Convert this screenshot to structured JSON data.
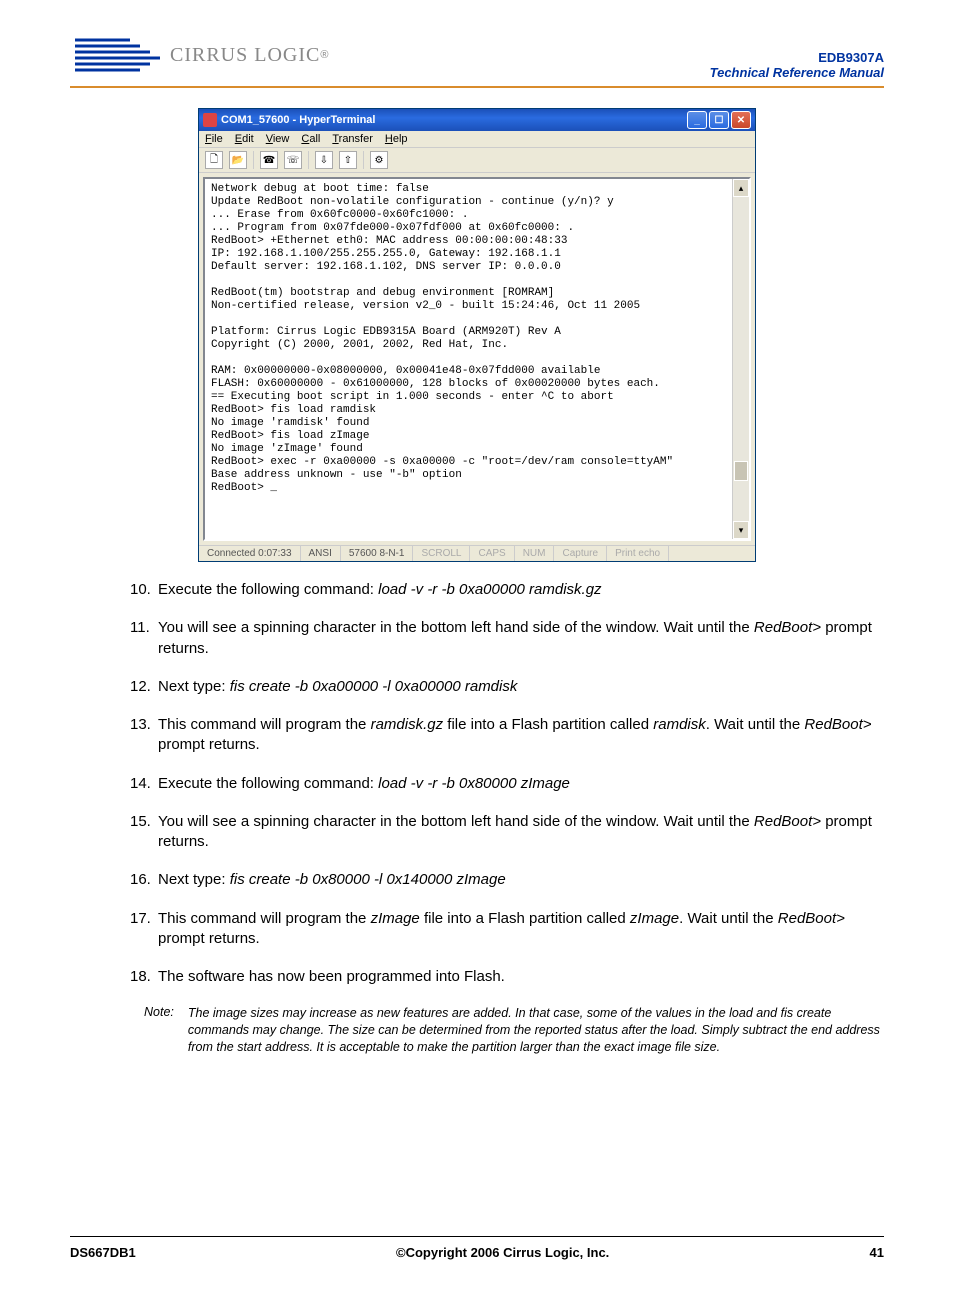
{
  "header": {
    "brand": "CIRRUS LOGIC",
    "product_code": "EDB9307A",
    "subtitle": "Technical Reference Manual"
  },
  "window": {
    "title": "COM1_57600 - HyperTerminal",
    "menu": {
      "file": "File",
      "edit": "Edit",
      "view": "View",
      "call": "Call",
      "transfer": "Transfer",
      "help": "Help"
    },
    "terminal_text": "Network debug at boot time: false\nUpdate RedBoot non-volatile configuration - continue (y/n)? y\n... Erase from 0x60fc0000-0x60fc1000: .\n... Program from 0x07fde000-0x07fdf000 at 0x60fc0000: .\nRedBoot> +Ethernet eth0: MAC address 00:00:00:00:48:33\nIP: 192.168.1.100/255.255.255.0, Gateway: 192.168.1.1\nDefault server: 192.168.1.102, DNS server IP: 0.0.0.0\n\nRedBoot(tm) bootstrap and debug environment [ROMRAM]\nNon-certified release, version v2_0 - built 15:24:46, Oct 11 2005\n\nPlatform: Cirrus Logic EDB9315A Board (ARM920T) Rev A\nCopyright (C) 2000, 2001, 2002, Red Hat, Inc.\n\nRAM: 0x00000000-0x08000000, 0x00041e48-0x07fdd000 available\nFLASH: 0x60000000 - 0x61000000, 128 blocks of 0x00020000 bytes each.\n== Executing boot script in 1.000 seconds - enter ^C to abort\nRedBoot> fis load ramdisk\nNo image 'ramdisk' found\nRedBoot> fis load zImage\nNo image 'zImage' found\nRedBoot> exec -r 0xa00000 -s 0xa00000 -c \"root=/dev/ram console=ttyAM\"\nBase address unknown - use \"-b\" option\nRedBoot> _",
    "status": {
      "connected": "Connected 0:07:33",
      "emul": "ANSI",
      "port": "57600 8-N-1",
      "scroll": "SCROLL",
      "caps": "CAPS",
      "num": "NUM",
      "capture": "Capture",
      "echo": "Print echo"
    }
  },
  "steps": {
    "s10_pre": "Execute the following command: ",
    "s10_cmd": "load -v -r -b 0xa00000 ramdisk.gz",
    "s11_a": "You will see a spinning character in the bottom left hand side of the window. Wait until the ",
    "s11_b": "RedBoot>",
    "s11_c": " prompt returns.",
    "s12_pre": " Next type: ",
    "s12_cmd": "fis create -b 0xa00000 -l 0xa00000 ramdisk",
    "s13_a": "This command will program the ",
    "s13_b": "ramdisk.gz",
    "s13_c": " file into a Flash partition called ",
    "s13_d": "ramdisk",
    "s13_e": ". Wait until the ",
    "s13_f": "RedBoot>",
    "s13_g": " prompt returns.",
    "s14_pre": "Execute the following command: ",
    "s14_cmd": "load -v -r -b 0x80000 zImage",
    "s15_a": "You will see a spinning character in the bottom left hand side of the window. Wait until the ",
    "s15_b": "RedBoot>",
    "s15_c": " prompt returns.",
    "s16_pre": "Next type: ",
    "s16_cmd": "fis create -b 0x80000 -l 0x140000 zImage",
    "s17_a": "This command will program the ",
    "s17_b": "zImage",
    "s17_c": " file into a Flash partition called ",
    "s17_d": "zImage",
    "s17_e": ". Wait until the ",
    "s17_f": "RedBoot>",
    "s17_g": " prompt returns.",
    "s18": "The software has now been programmed into Flash."
  },
  "note": {
    "label": "Note:",
    "body": "The image sizes may increase as new features are added. In that case, some of the values in the load and fis create commands may change. The size can be determined from the reported status after the load. Simply subtract the end address from the start address. It is acceptable to make the partition larger than the exact image file size."
  },
  "footer": {
    "left": "DS667DB1",
    "center": "©Copyright 2006 Cirrus Logic, Inc.",
    "right": "41"
  }
}
